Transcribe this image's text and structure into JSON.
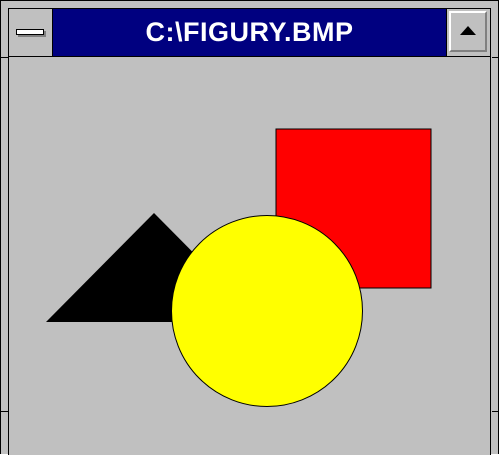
{
  "window": {
    "title": "C:\\FIGURY.BMP"
  },
  "titlebar": {
    "system_menu_icon": "system-menu-icon",
    "maximize_icon": "maximize-arrow-icon",
    "active_color": "#000080"
  },
  "canvas": {
    "background_color": "#c0c0c0",
    "shapes": [
      {
        "kind": "triangle",
        "fill": "#000000"
      },
      {
        "kind": "square",
        "fill": "#ff0000"
      },
      {
        "kind": "circle",
        "fill": "#ffff00"
      }
    ]
  }
}
